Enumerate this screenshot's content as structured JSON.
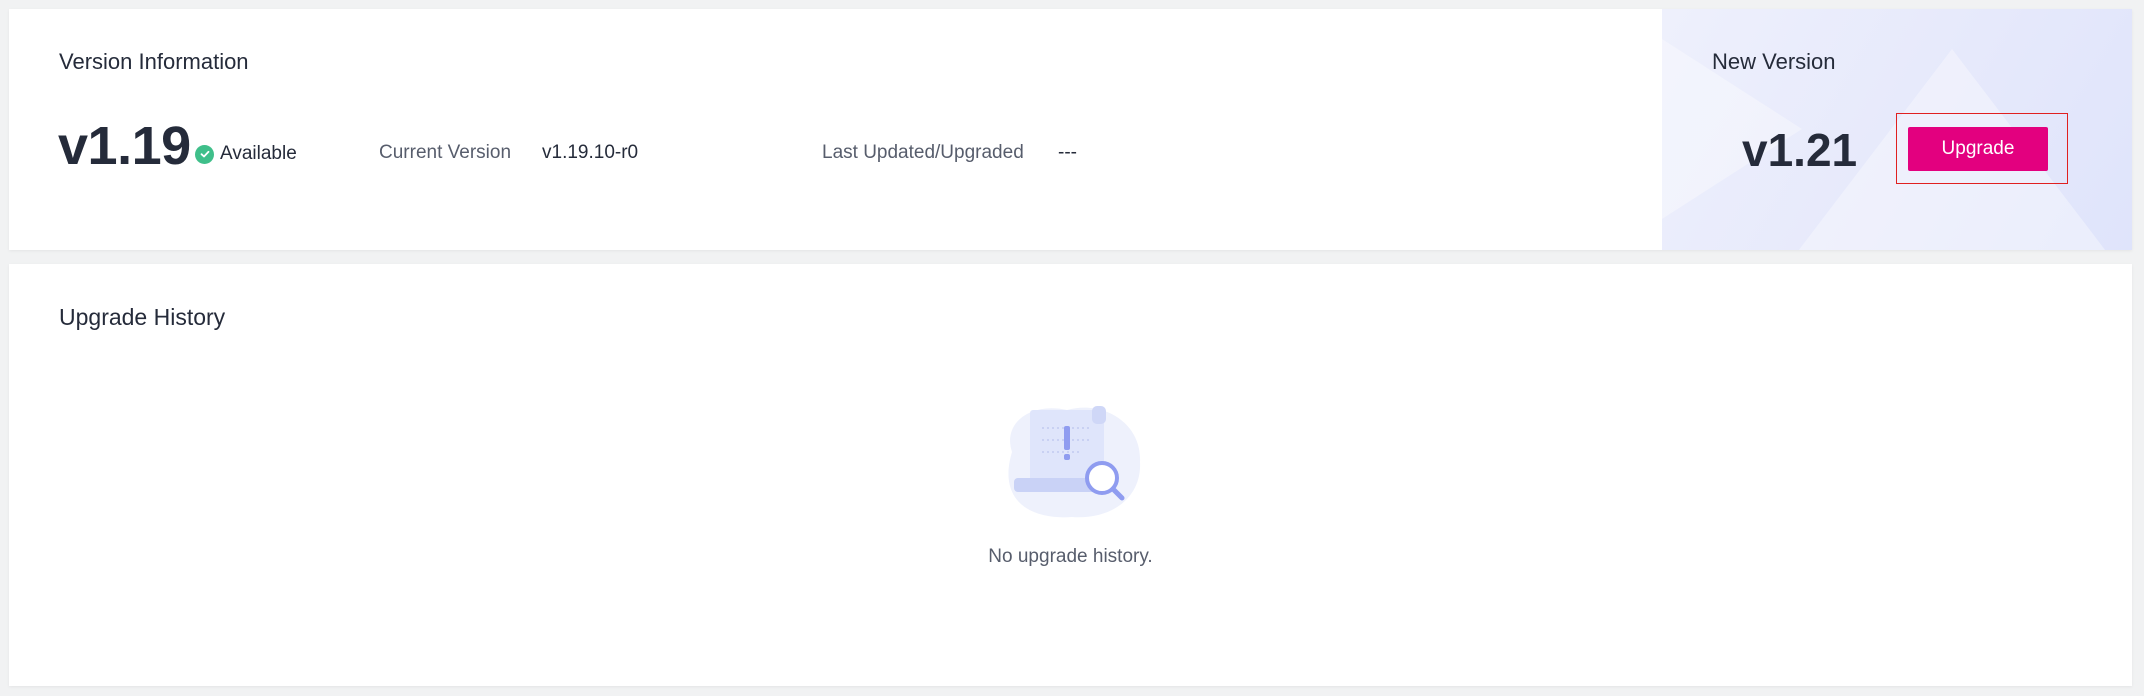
{
  "version_info": {
    "title": "Version Information",
    "current_major": "v1.19",
    "status": "Available",
    "current_version_label": "Current Version",
    "current_version_value": "v1.19.10-r0",
    "last_updated_label": "Last Updated/Upgraded",
    "last_updated_value": "---"
  },
  "new_version": {
    "title": "New Version",
    "version": "v1.21",
    "upgrade_label": "Upgrade"
  },
  "upgrade_history": {
    "title": "Upgrade History",
    "empty_text": "No upgrade history."
  },
  "colors": {
    "accent": "#e3007f",
    "status_ok": "#3fbf8a",
    "highlight": "#e02020"
  },
  "icons": {
    "status": "check-circle-icon",
    "empty": "empty-document-search-illustration"
  }
}
